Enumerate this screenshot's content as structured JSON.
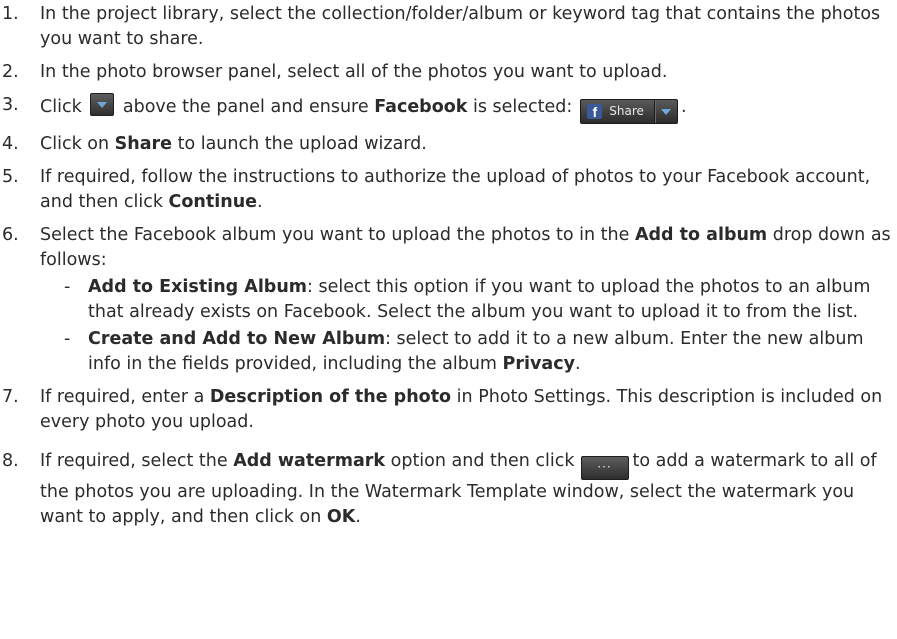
{
  "steps": [
    {
      "num": "1.",
      "text": "In the project library, select the collection/folder/album or keyword tag that contains the photos you want to share."
    },
    {
      "num": "2.",
      "text": "In the photo browser panel, select all of the photos you want to upload."
    },
    {
      "num": "3.",
      "pre": "Click",
      "mid": "above the panel and ensure",
      "bold": "Facebook",
      "post": "is selected:",
      "end": "."
    },
    {
      "num": "4.",
      "pre": "Click on",
      "bold": "Share",
      "post": "to launch the upload wizard."
    },
    {
      "num": "5.",
      "pre": "If required, follow the instructions to authorize the upload of photos to your Facebook account, and then click",
      "bold": "Continue",
      "end": "."
    },
    {
      "num": "6.",
      "pre": "Select the Facebook album you want to upload the photos to in the",
      "bold": "Add to album",
      "post": "drop down as follows:"
    },
    {
      "num": "7.",
      "pre": "If required, enter a",
      "bold": "Description of the photo",
      "post": "in Photo Settings. This description is included on every photo you upload."
    },
    {
      "num": "8.",
      "pre": "If required, select the",
      "bold": "Add watermark",
      "mid": "option and then click",
      "post": "to add a watermark to all of the photos you are uploading. In the Watermark Template window, select the watermark you want to apply, and then click on",
      "bold2": "OK",
      "end": "."
    }
  ],
  "album_options": [
    {
      "dash": "-",
      "bold": "Add to Existing Album",
      "text": ": select this option if you want to upload the photos to an album that already exists on Facebook. Select the album you want to upload it to from the list."
    },
    {
      "dash": "-",
      "bold": "Create and Add to New Album",
      "text": ": select to add it to a new album. Enter the new album info in the fields provided, including the album",
      "bold2": "Privacy",
      "end": "."
    }
  ],
  "share_widget": {
    "icon_letter": "f",
    "label": "Share"
  },
  "more_button": {
    "label": "···"
  },
  "colors": {
    "facebook_blue": "#3b5998",
    "button_dark": "#2f2f2f",
    "arrow_blue": "#6ea6d8",
    "text": "#2b2b2b"
  },
  "icons": {
    "dropdown_button": "dropdown-arrow-icon",
    "share": "facebook-icon",
    "share_dropdown": "dropdown-arrow-icon",
    "more": "ellipsis-icon"
  }
}
